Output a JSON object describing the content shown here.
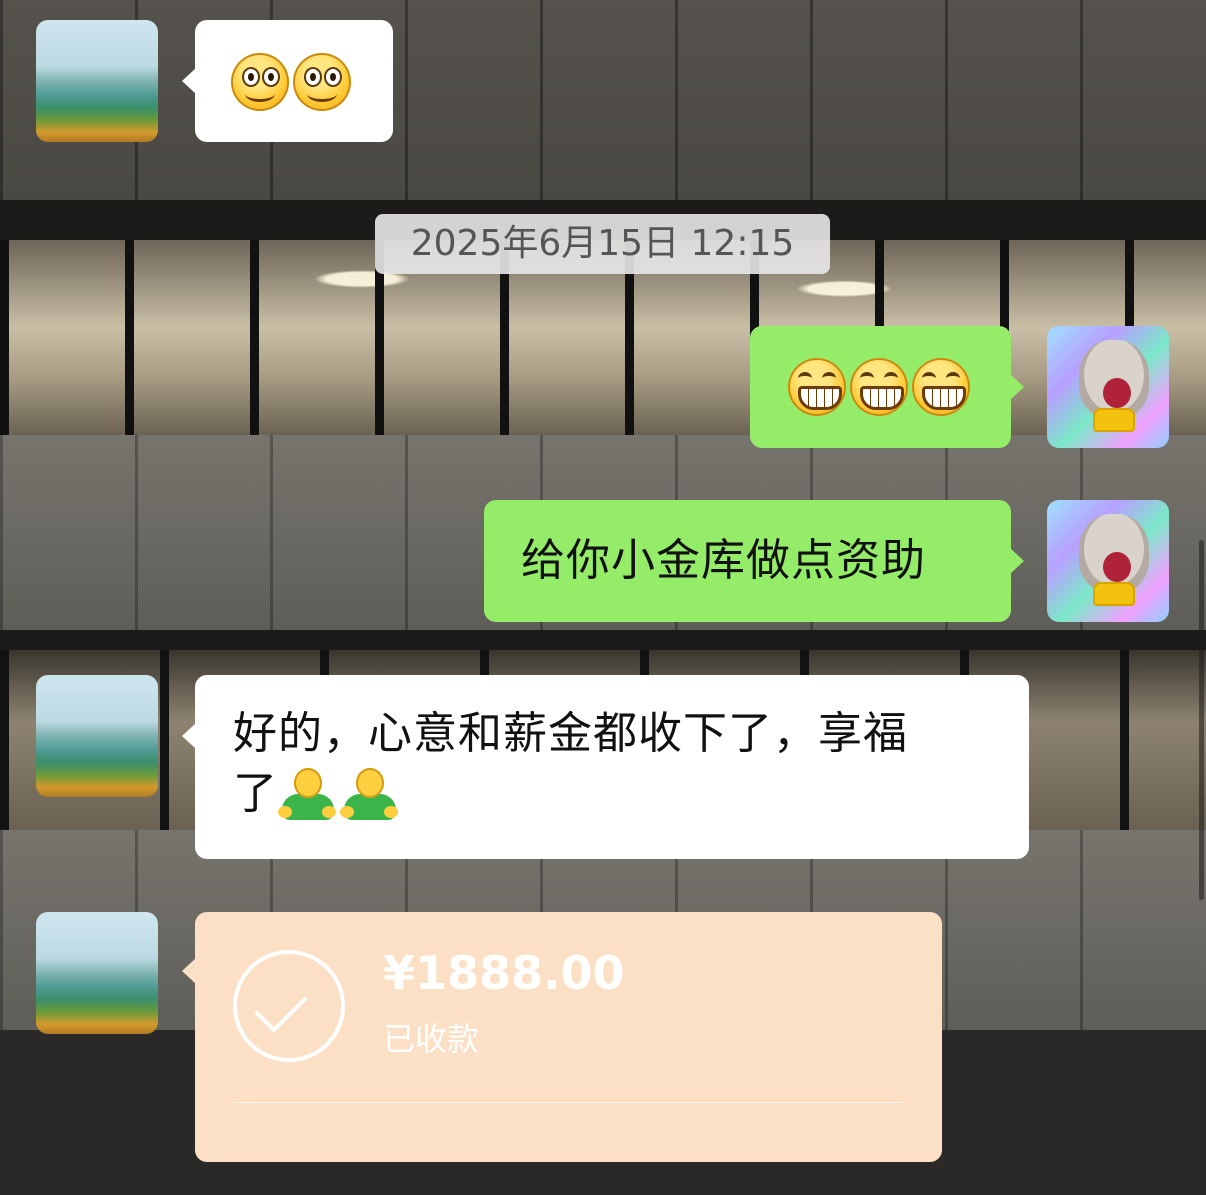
{
  "messages": [
    {
      "side": "left",
      "type": "emoji",
      "emojis": [
        "smile-emoji",
        "smile-emoji"
      ]
    },
    {
      "side": "right",
      "type": "emoji",
      "emojis": [
        "grin-emoji",
        "grin-emoji",
        "grin-emoji"
      ]
    },
    {
      "side": "right",
      "type": "text",
      "text": "给你小金库做点资助"
    },
    {
      "side": "left",
      "type": "text",
      "text_line1": "好的，心意和薪金都收下了，享福",
      "text_line2": "了",
      "emojis": [
        "man-emoji",
        "man-emoji"
      ]
    }
  ],
  "timestamp": "2025年6月15日 12:15",
  "transfer": {
    "amount": "¥1888.00",
    "status": "已收款"
  },
  "colors": {
    "sent_bubble": "#95ec69",
    "received_bubble": "#ffffff",
    "transfer_card": "#fbe0c5",
    "timestamp_bg": "#e8e8e8"
  },
  "avatars": {
    "other": "landscape-avatar",
    "self": "cat-avatar"
  }
}
